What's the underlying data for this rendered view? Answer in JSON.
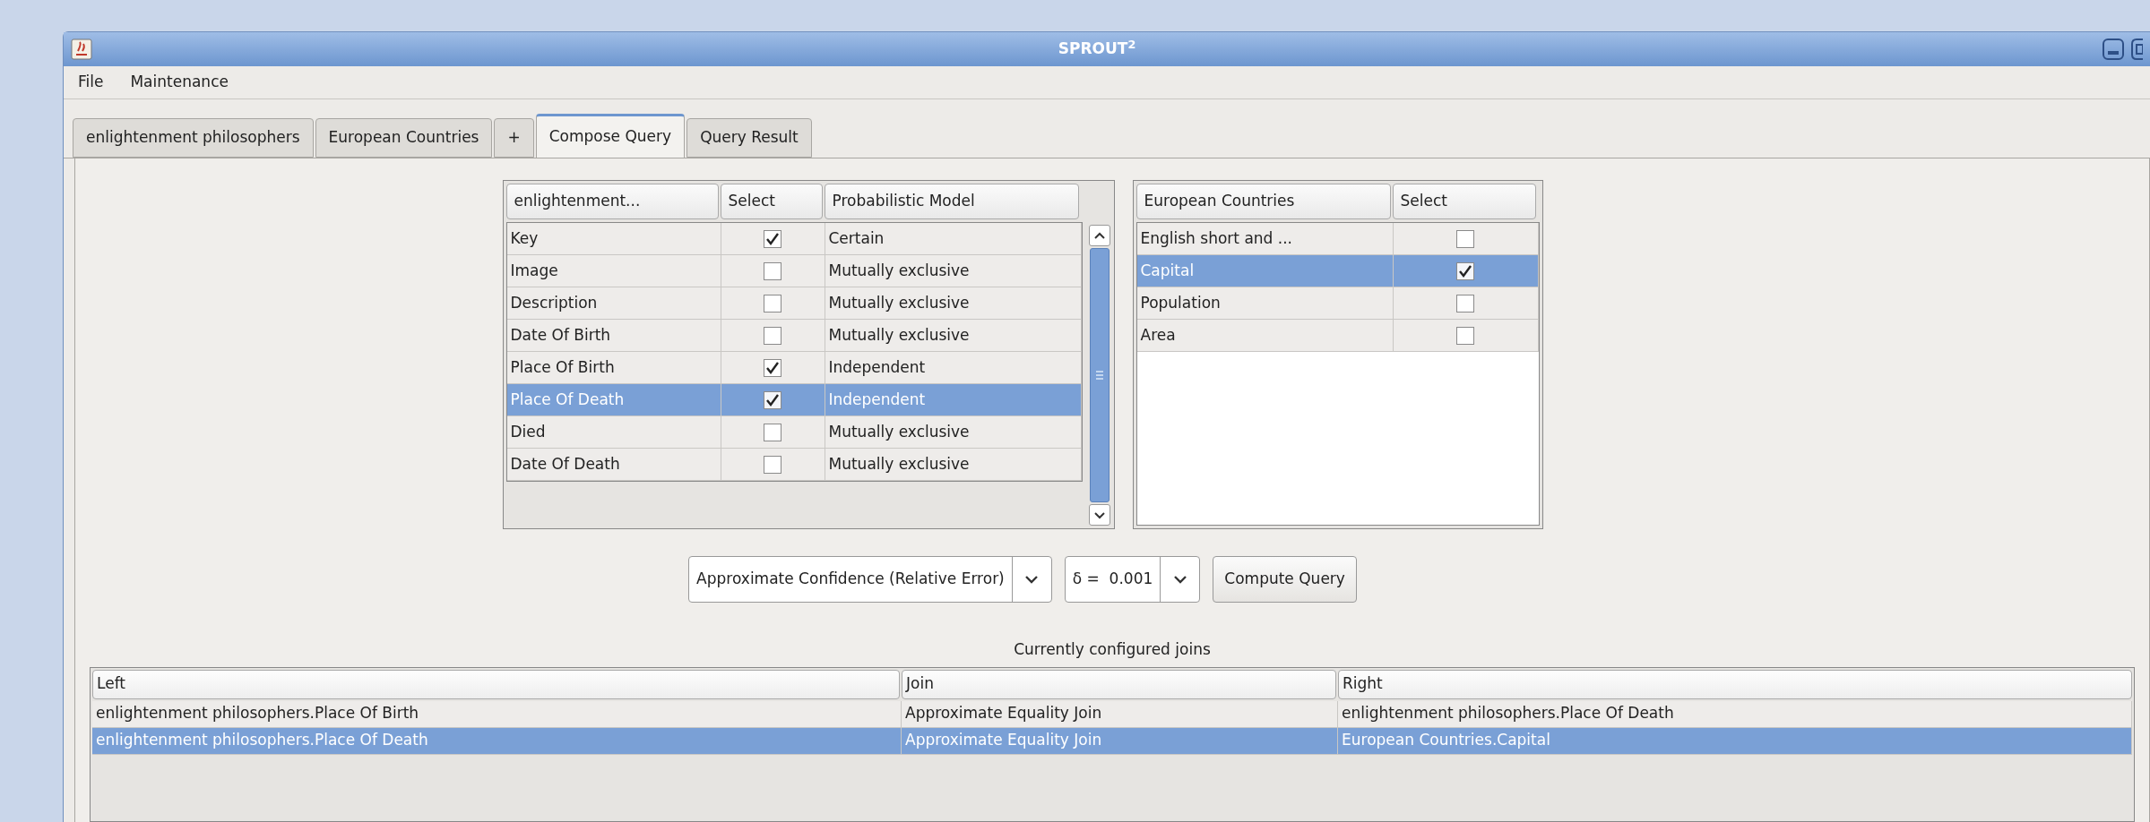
{
  "window": {
    "title": "SPROUT$^{2}$"
  },
  "menu": [
    "File",
    "Maintenance"
  ],
  "tabs": [
    {
      "label": "enlightenment philosophers",
      "selected": false
    },
    {
      "label": "European Countries",
      "selected": false
    },
    {
      "label": "+",
      "selected": false
    },
    {
      "label": "Compose Query",
      "selected": true
    },
    {
      "label": "Query Result",
      "selected": false
    }
  ],
  "attributes_table": {
    "columns": [
      "enlightenment...",
      "Select",
      "Probabilistic Model"
    ],
    "rows": [
      {
        "name": "Key",
        "checked": true,
        "model": "Certain",
        "selected": false
      },
      {
        "name": "Image",
        "checked": false,
        "model": "Mutually exclusive",
        "selected": false
      },
      {
        "name": "Description",
        "checked": false,
        "model": "Mutually exclusive",
        "selected": false
      },
      {
        "name": "Date Of Birth",
        "checked": false,
        "model": "Mutually exclusive",
        "selected": false
      },
      {
        "name": "Place Of Birth",
        "checked": true,
        "model": "Independent",
        "selected": false
      },
      {
        "name": "Place Of Death",
        "checked": true,
        "model": "Independent",
        "selected": true
      },
      {
        "name": "Died",
        "checked": false,
        "model": "Mutually exclusive",
        "selected": false
      },
      {
        "name": "Date Of Death",
        "checked": false,
        "model": "Mutually exclusive",
        "selected": false
      }
    ]
  },
  "countries_table": {
    "columns": [
      "European Countries",
      "Select"
    ],
    "rows": [
      {
        "name": "English short and ...",
        "checked": false,
        "selected": false
      },
      {
        "name": "Capital",
        "checked": true,
        "selected": true
      },
      {
        "name": "Population",
        "checked": false,
        "selected": false
      },
      {
        "name": "Area",
        "checked": false,
        "selected": false
      }
    ]
  },
  "confidence_select": {
    "value": "Approximate Confidence (Relative Error)"
  },
  "delta_select": {
    "value": "δ =  0.001"
  },
  "compute_button": "Compute Query",
  "joins": {
    "title": "Currently configured joins",
    "columns": [
      "Left",
      "Join",
      "Right"
    ],
    "rows": [
      {
        "left": "enlightenment philosophers.Place Of Birth",
        "join": "Approximate Equality Join",
        "right": "enlightenment philosophers.Place Of Death",
        "selected": false
      },
      {
        "left": "enlightenment philosophers.Place Of Death",
        "join": "Approximate Equality Join",
        "right": "European Countries.Capital",
        "selected": true
      }
    ]
  }
}
